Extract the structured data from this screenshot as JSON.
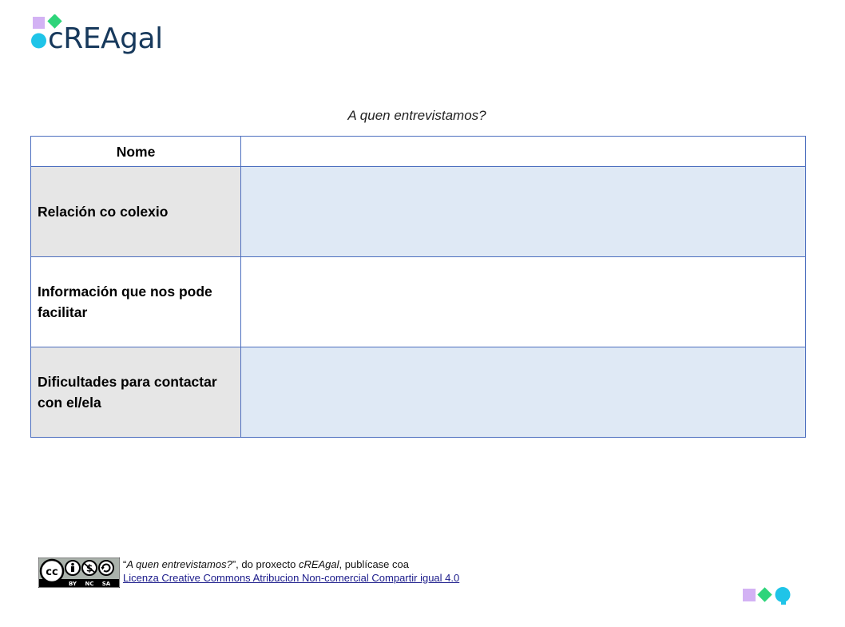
{
  "brand": {
    "name": "cREAgal",
    "colors": {
      "navy": "#17395c",
      "cyan": "#1fc4e8",
      "green": "#2ed47a",
      "lilac": "#d3b2f4"
    }
  },
  "page": {
    "subtitle": "A quen entrevistamos?"
  },
  "table": {
    "header_label": "Nome",
    "header_value": "",
    "rows": [
      {
        "label": "Relación co colexio",
        "value": ""
      },
      {
        "label": "Información que nos pode facilitar",
        "value": ""
      },
      {
        "label": "Dificultades para contactar con el/ela",
        "value": ""
      }
    ],
    "colors": {
      "border": "#4d6fbf",
      "label_grey": "#e6e6e6",
      "value_blue": "#dfe9f5"
    }
  },
  "footer": {
    "quote_open": "“",
    "work_title": "A quen entrevistamos?",
    "quote_close": "”",
    "text_mid": ", do proxecto ",
    "project_name": "cREAgal",
    "text_end": ", publícase coa",
    "license_link": "Licenza Creative Commons Atribucion Non-comercial Compartir igual 4.0",
    "badge_labels": [
      "BY",
      "NC",
      "SA"
    ]
  }
}
